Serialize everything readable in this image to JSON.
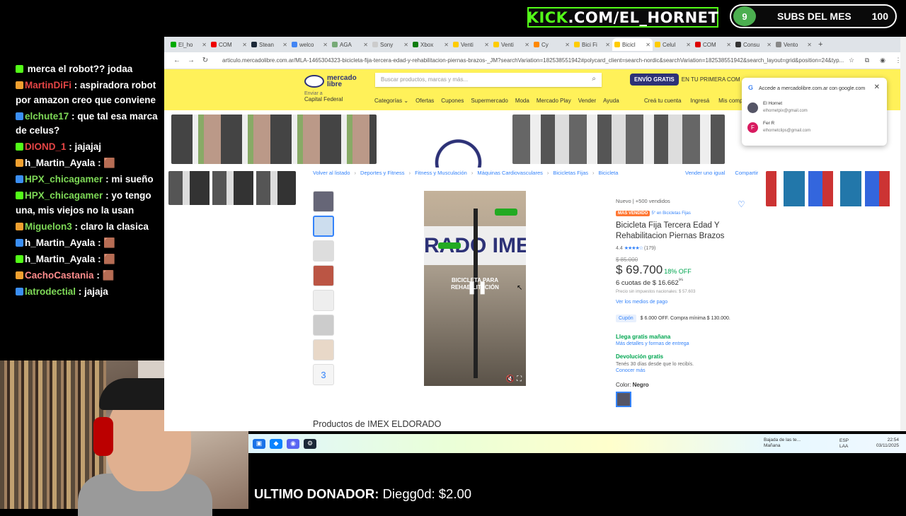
{
  "overlay": {
    "kick_prefix": "KICK",
    "kick_suffix": ".COM/EL_HORNET",
    "subs_count_circle": "9",
    "subs_label": "SUBS DEL MES",
    "subs_total": "100",
    "donor_label": "ULTIMO DONADOR:",
    "donor_value": "Diegg0d: $2.00"
  },
  "chat": [
    {
      "user": "",
      "text": "merca el robot?? jodaa",
      "color": "#ffffff"
    },
    {
      "user": "MartinDiFi",
      "text": ": aspiradora robot por amazon creo que conviene",
      "color": "#e54545"
    },
    {
      "user": "elchute17",
      "text": ": que tal esa marca de celus?",
      "color": "#7ed957"
    },
    {
      "user": "DIOND_1",
      "text": ": jajajaj",
      "color": "#e54545"
    },
    {
      "user": "h_Martin_Ayala",
      "text": ": 🟫",
      "color": "#ffffff"
    },
    {
      "user": "HPX_chicagamer",
      "text": ": mi sueño",
      "color": "#7ed957"
    },
    {
      "user": "HPX_chicagamer",
      "text": ": yo tengo una, mis viejos no la usan",
      "color": "#7ed957"
    },
    {
      "user": "Miguelon3",
      "text": ": claro la clasica",
      "color": "#7ed957"
    },
    {
      "user": "h_Martin_Ayala",
      "text": ": 🟫",
      "color": "#ffffff"
    },
    {
      "user": "h_Martin_Ayala",
      "text": ": 🟫",
      "color": "#ffffff"
    },
    {
      "user": "CachoCastania",
      "text": ": 🟫",
      "color": "#ff8c8c"
    },
    {
      "user": "latrodectial",
      "text": ": jajaja",
      "color": "#7ed957"
    }
  ],
  "browser": {
    "tabs": [
      "El_ho",
      "COM",
      "Stean",
      "welco",
      "AGA",
      "Sony",
      "Xbox",
      "Venti",
      "Venti",
      "Cy",
      "Bici Fi",
      "Bicicl",
      "Celul",
      "COM",
      "Consu",
      "Vento"
    ],
    "url": "articulo.mercadolibre.com.ar/MLA-1465304323-bicicleta-fija-tercera-edad-y-rehabilitacion-piernas-brazos-_JM?searchVariation=182538551942#polycard_client=search-nordic&searchVariation=182538551942&search_layout=grid&position=24&typ..."
  },
  "ml": {
    "logo_line1": "mercado",
    "logo_line2": "libre",
    "search_placeholder": "Buscar productos, marcas y más...",
    "envio_pill": "ENVÍO GRATIS",
    "envio_text": "EN TU PRIMERA COM",
    "loc_line1": "Enviar a",
    "loc_line2": "Capital Federal",
    "nav": [
      "Categorías ⌄",
      "Ofertas",
      "Cupones",
      "Supermercado",
      "Moda",
      "Mercado Play",
      "Vender",
      "Ayuda"
    ],
    "nav_right": [
      "Creá tu cuenta",
      "Ingresá",
      "Mis compras"
    ],
    "google": {
      "title": "Accede a mercadolibre.com.ar con google.com",
      "acc1_name": "El Hornet",
      "acc1_email": "elhornetpix@gmail.com",
      "acc2_initial": "F",
      "acc2_name": "Fer R",
      "acc2_email": "elhornetclips@gmail.com"
    },
    "crumbs": [
      "Volver al listado",
      "Deportes y Fitness",
      "Fitness y Musculación",
      "Máquinas Cardiovasculares",
      "Bicicletas Fijas",
      "Bicicleta"
    ],
    "crumbs_right": [
      "Vender uno igual",
      "Compartir"
    ],
    "thumb_more": "3",
    "video_sign": "RADO IMEX",
    "video_caption": "BICICLETA PARA REHABILITACIÓN",
    "product": {
      "condition": "Nuevo | +500 vendidos",
      "badge": "MÁS VENDIDO",
      "badge_rank": "5° en Bicicletas Fijas",
      "title": "Bicicleta Fija Tercera Edad Y Rehabilitacion Piernas Brazos",
      "rating": "4.4",
      "reviews": "(179)",
      "old_price": "$ 85.000",
      "price": "$ 69.700",
      "discount": "18% OFF",
      "cuotas": "6 cuotas de $ 16.662",
      "cuotas_cents": "⁹⁵",
      "impuestos": "Precio sin impuestos nacionales: $ 57.603",
      "medios": "Ver los medios de pago",
      "cupon_label": "Cupón",
      "cupon_text": "$ 6.000 OFF. Compra mínima $ 130.000.",
      "llega": "Llega gratis mañana",
      "llega_link": "Más detalles y formas de entrega",
      "devolucion": "Devolución gratis",
      "devolucion_text": "Tenés 30 días desde que lo recibís.",
      "conocer": "Conocer más",
      "color_label": "Color:",
      "color_value": "Negro"
    },
    "products_title": "Productos de IMEX ELDORADO"
  },
  "taskbar": {
    "notif_line1": "Bajada de las te...",
    "notif_line2": "Mañana",
    "lang1": "ESP",
    "lang2": "LAA",
    "time": "22:54",
    "date": "03/11/2025"
  }
}
